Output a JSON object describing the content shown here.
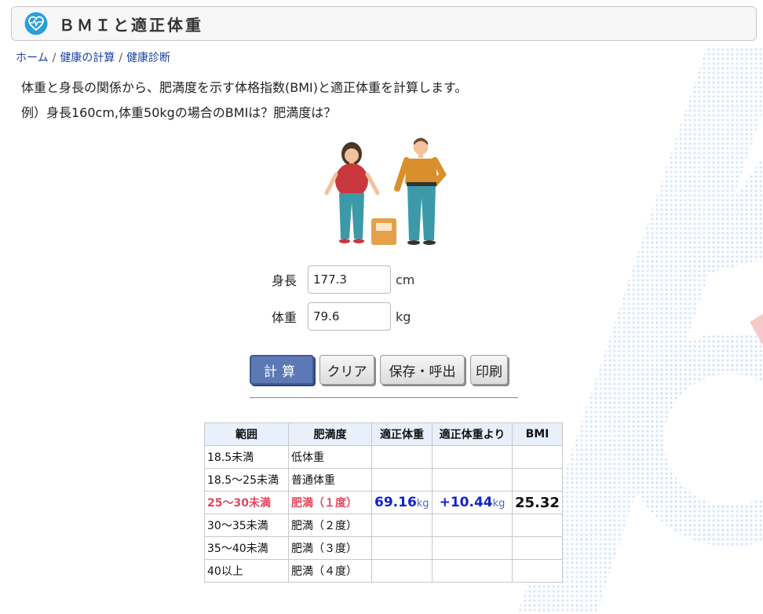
{
  "title": "ＢＭＩと適正体重",
  "breadcrumb": [
    "ホーム",
    "健康の計算",
    "健康診断"
  ],
  "description": {
    "line1": "体重と身長の関係から、肥満度を示す体格指数(BMI)と適正体重を計算します。",
    "line2": "例）身長160cm,体重50kgの場合のBMIは？肥満度は？"
  },
  "form": {
    "height_label": "身長",
    "height_value": "177.3",
    "height_unit": "cm",
    "weight_label": "体重",
    "weight_value": "79.6",
    "weight_unit": "kg"
  },
  "buttons": {
    "calc": "計算",
    "clear": "クリア",
    "save": "保存・呼出",
    "print": "印刷"
  },
  "table": {
    "headers": [
      "範囲",
      "肥満度",
      "適正体重",
      "適正体重より",
      "BMI"
    ],
    "rows": [
      {
        "range": "18.5未満",
        "level": "低体重"
      },
      {
        "range": "18.5～25未満",
        "level": "普通体重"
      },
      {
        "range": "25～30未満",
        "level": "肥満（１度）",
        "ideal_weight": "69.16",
        "diff": "+10.44",
        "unit": "kg",
        "bmi": "25.32"
      },
      {
        "range": "30～35未満",
        "level": "肥満（２度）"
      },
      {
        "range": "35～40未満",
        "level": "肥満（３度）"
      },
      {
        "range": "40以上",
        "level": "肥満（４度）"
      }
    ]
  },
  "colors": {
    "accent_button": "#5c79b5",
    "highlight_row": "#e2475e",
    "result_blue": "#1025c8",
    "bmi_red": "#e01010",
    "icon_blue": "#2a9fd8"
  },
  "icons": {
    "title": "heart-pulse-icon"
  }
}
